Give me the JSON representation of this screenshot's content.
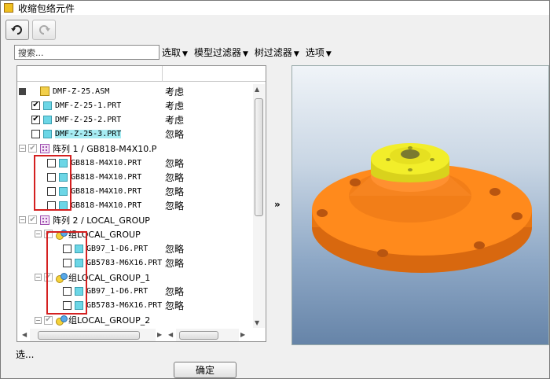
{
  "window": {
    "title": "收缩包络元件"
  },
  "toolbar": {
    "undo_icon": "undo-icon",
    "redo_icon": "redo-icon"
  },
  "search": {
    "placeholder": "搜索..."
  },
  "menus": [
    {
      "label": "选取"
    },
    {
      "label": "模型过滤器"
    },
    {
      "label": "树过滤器"
    },
    {
      "label": "选项"
    }
  ],
  "tree": {
    "rows": [
      {
        "label": "DMF-Z-25.ASM",
        "status": "考虑"
      },
      {
        "label": "DMF-Z-25-1.PRT",
        "status": "考虑"
      },
      {
        "label": "DMF-Z-25-2.PRT",
        "status": "考虑"
      },
      {
        "label": "DMF-Z-25-3.PRT",
        "status": "忽略"
      },
      {
        "label": "阵列 1 / GB818-M4X10.P",
        "status": ""
      },
      {
        "label": "GB818-M4X10.PRT",
        "status": "忽略"
      },
      {
        "label": "GB818-M4X10.PRT",
        "status": "忽略"
      },
      {
        "label": "GB818-M4X10.PRT",
        "status": "忽略"
      },
      {
        "label": "GB818-M4X10.PRT",
        "status": "忽略"
      },
      {
        "label": "阵列 2 / LOCAL_GROUP",
        "status": ""
      },
      {
        "label": "组LOCAL_GROUP",
        "status": ""
      },
      {
        "label": "GB97_1-D6.PRT",
        "status": "忽略"
      },
      {
        "label": "GB5783-M6X16.PRT",
        "status": "忽略"
      },
      {
        "label": "组LOCAL_GROUP_1",
        "status": ""
      },
      {
        "label": "GB97_1-D6.PRT",
        "status": "忽略"
      },
      {
        "label": "GB5783-M6X16.PRT",
        "status": "忽略"
      },
      {
        "label": "组LOCAL_GROUP_2",
        "status": ""
      }
    ]
  },
  "expand_label": "»",
  "status_text": "选...",
  "ok_label": "确定",
  "colors": {
    "flange": "#ff8a1c",
    "hub": "#f2ee2a",
    "highlight": "#a6ecf3",
    "annotation": "#d42020"
  }
}
